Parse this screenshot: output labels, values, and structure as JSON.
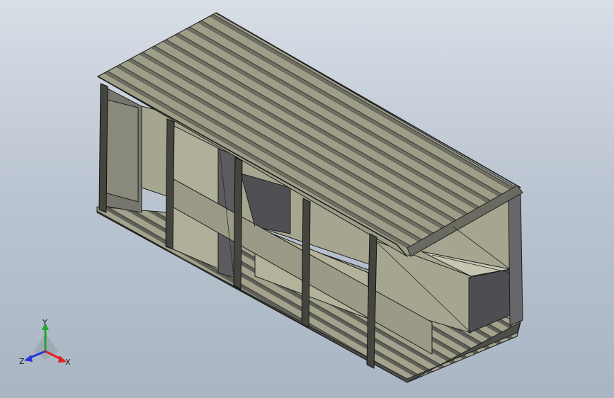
{
  "viewport": {
    "background_top": "#d8dee6",
    "background_bottom": "#a9b5c3",
    "model": {
      "name": "container-model",
      "face_color": "#a3a38e",
      "shadow_color": "#6c6c62",
      "dark_color": "#56565a",
      "edge_color": "#1e1e1e"
    }
  },
  "triad": {
    "x_label": "X",
    "y_label": "Y",
    "z_label": "Z",
    "x_color": "#e0201e",
    "y_color": "#1ea82a",
    "z_color": "#2a34d8"
  }
}
